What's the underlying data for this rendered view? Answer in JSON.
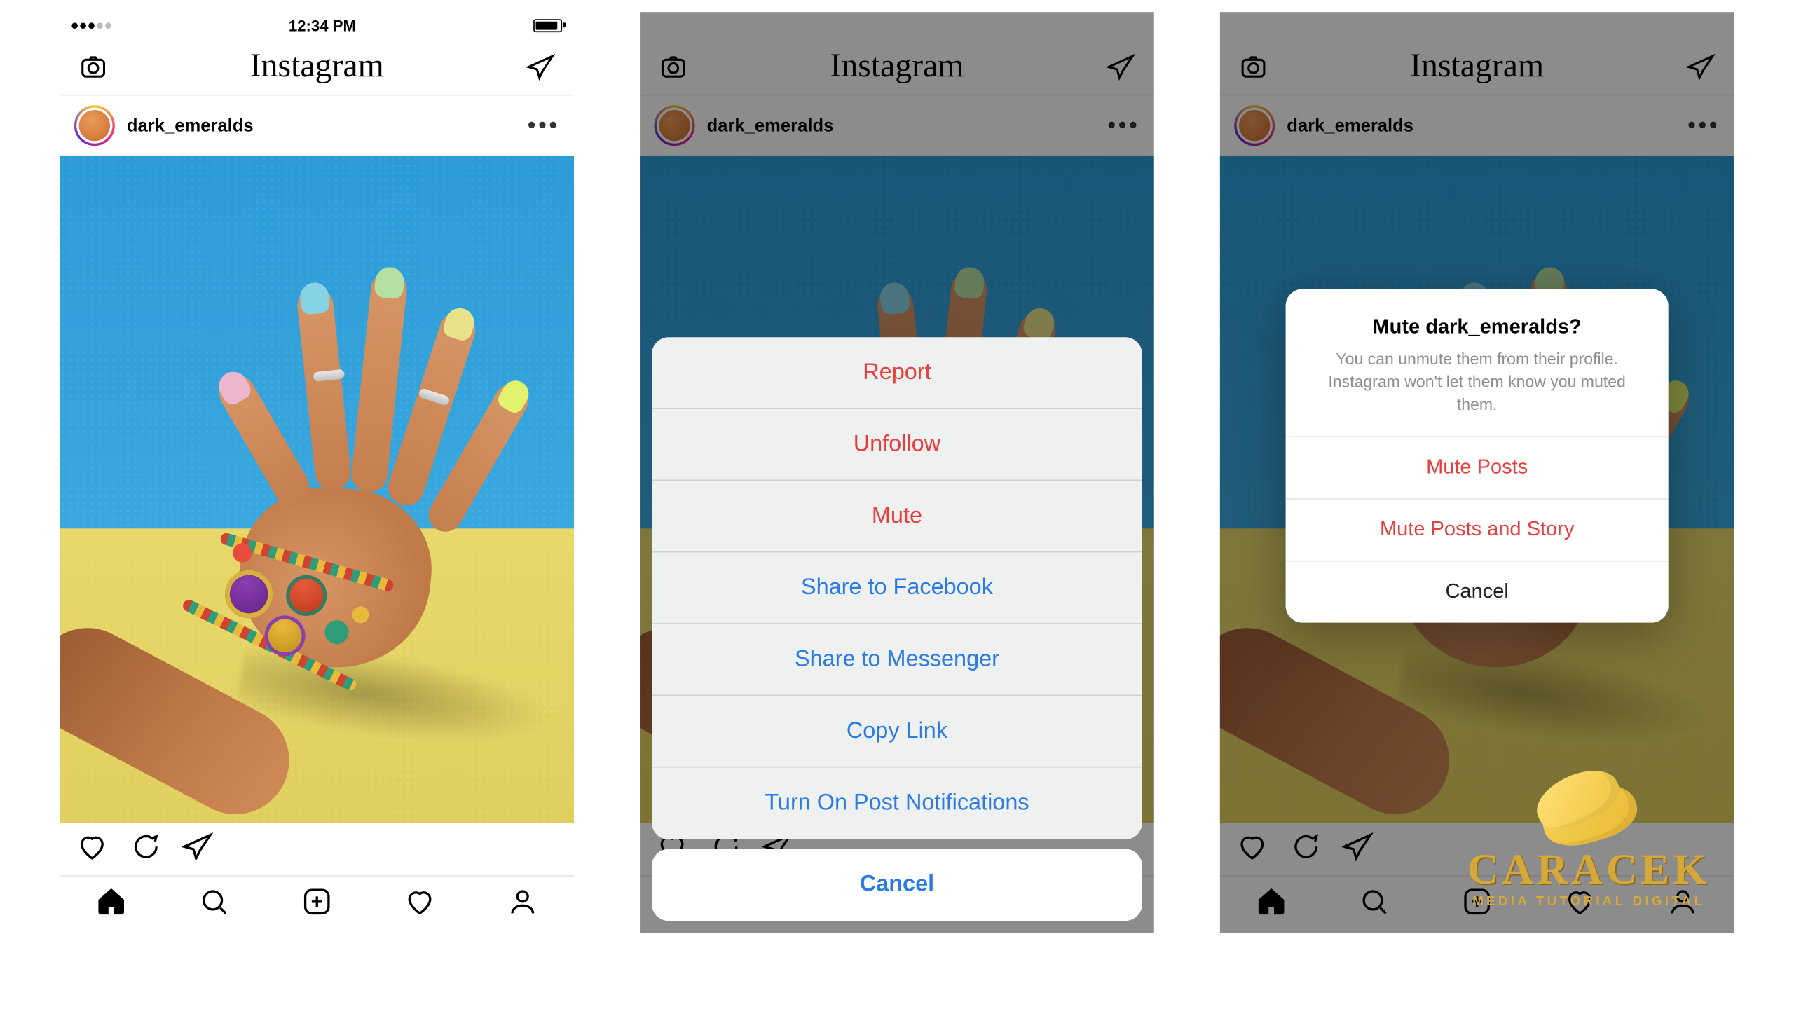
{
  "status": {
    "time": "12:34 PM"
  },
  "header": {
    "logo": "Instagram"
  },
  "post": {
    "username": "dark_emeralds"
  },
  "actionSheet": {
    "items": [
      {
        "label": "Report",
        "style": "red"
      },
      {
        "label": "Unfollow",
        "style": "red"
      },
      {
        "label": "Mute",
        "style": "red"
      },
      {
        "label": "Share to Facebook",
        "style": "blue"
      },
      {
        "label": "Share to Messenger",
        "style": "blue"
      },
      {
        "label": "Copy Link",
        "style": "blue"
      },
      {
        "label": "Turn On Post Notifications",
        "style": "blue"
      }
    ],
    "cancel": "Cancel"
  },
  "muteDialog": {
    "title": "Mute dark_emeralds?",
    "message": "You can unmute them from their profile. Instagram won't let them know you muted them.",
    "opt1": "Mute Posts",
    "opt2": "Mute Posts and Story",
    "cancel": "Cancel"
  },
  "watermark": {
    "title": "CARACEK",
    "sub": "MEDIA TUTORIAL DIGITAL"
  }
}
